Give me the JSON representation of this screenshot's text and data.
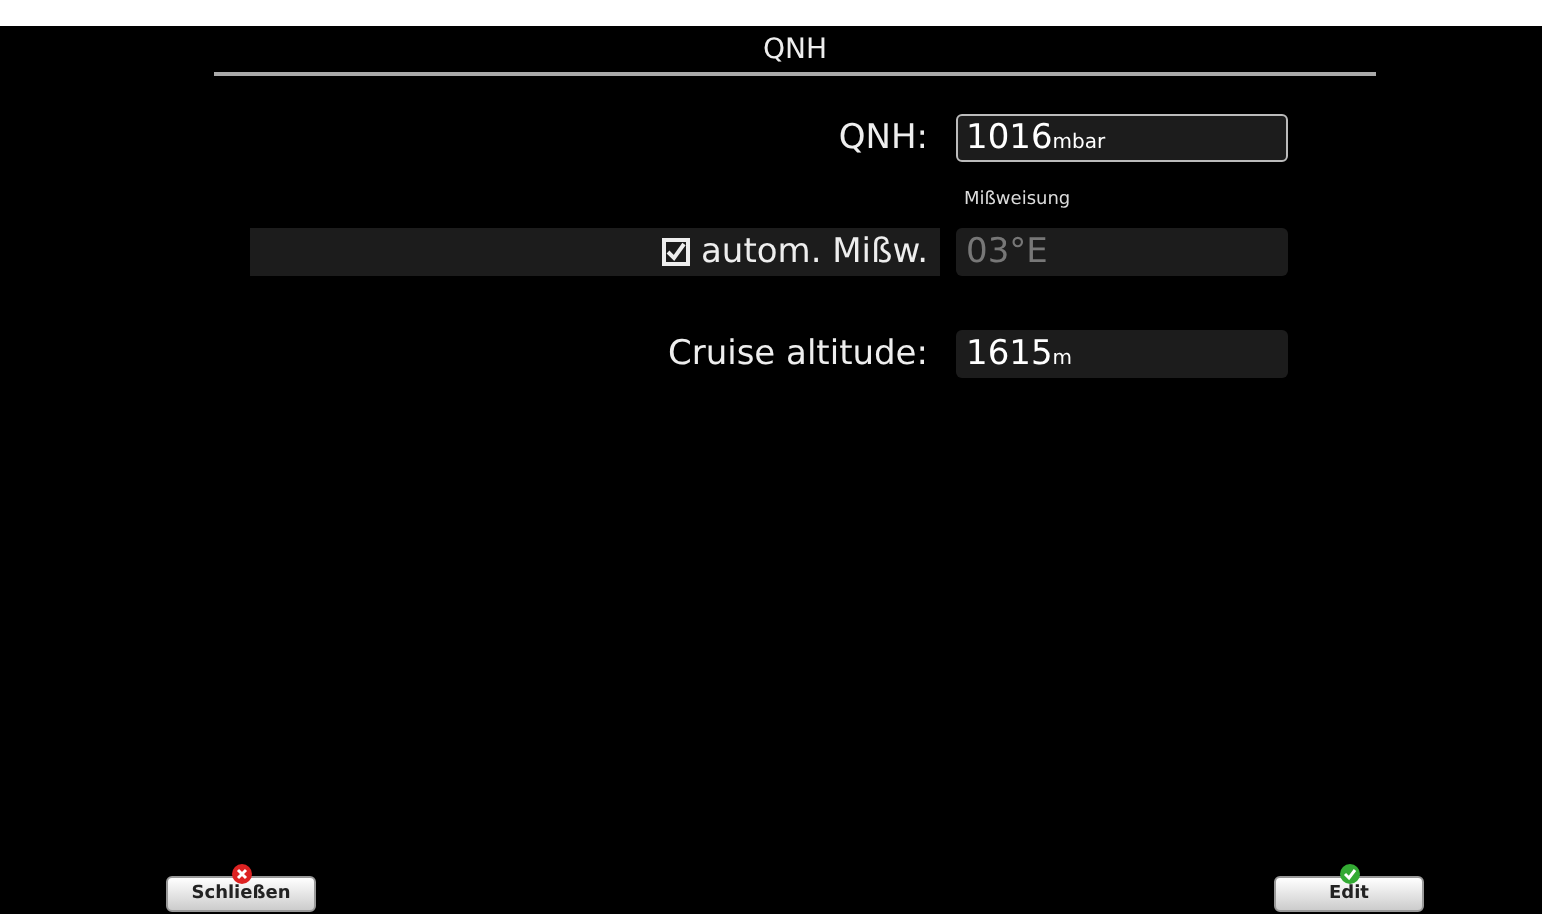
{
  "window": {
    "title": "QNH"
  },
  "fields": [
    {
      "kind": "field",
      "label": "QNH:",
      "value": "1016",
      "unit": "mbar",
      "editable": true
    },
    {
      "kind": "checkbox",
      "caption": "Mißweisung",
      "label": "autom. Mißw.",
      "checked": true,
      "value": "03°E",
      "disabled": true
    },
    {
      "kind": "field",
      "label": "Cruise altitude:",
      "value": "1615",
      "unit": "m",
      "editable": false
    }
  ],
  "buttons": [
    {
      "label": "Schließen",
      "kind": "close"
    },
    {
      "label": "Edit",
      "kind": "ok"
    }
  ]
}
